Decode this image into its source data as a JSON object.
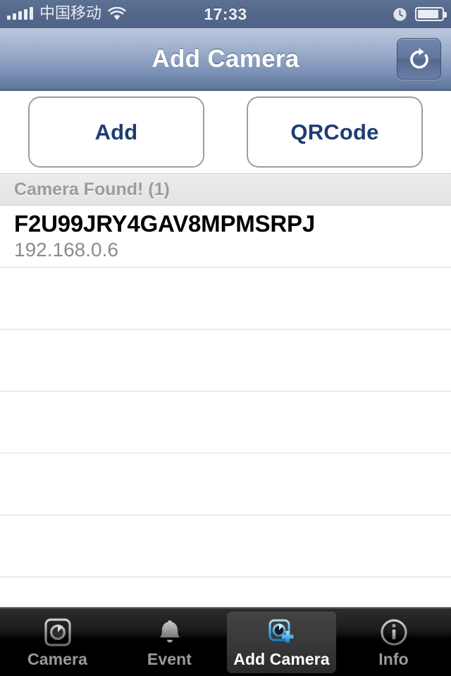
{
  "status_bar": {
    "carrier": "中国移动",
    "time": "17:33",
    "signal_bars": 5,
    "wifi_icon": "wifi-icon",
    "clock_icon": "clock-icon",
    "battery_icon": "battery-icon"
  },
  "nav_bar": {
    "title": "Add Camera",
    "refresh_icon": "refresh-icon"
  },
  "actions": {
    "add_label": "Add",
    "qrcode_label": "QRCode"
  },
  "section": {
    "header": "Camera Found! (1)"
  },
  "camera_list": [
    {
      "id": "F2U99JRY4GAV8MPMSRPJ",
      "ip": "192.168.0.6"
    }
  ],
  "empty_rows": 5,
  "tab_bar": {
    "items": [
      {
        "label": "Camera",
        "icon": "camera-icon",
        "selected": false
      },
      {
        "label": "Event",
        "icon": "bell-icon",
        "selected": false
      },
      {
        "label": "Add Camera",
        "icon": "add-camera-icon",
        "selected": true
      },
      {
        "label": "Info",
        "icon": "info-icon",
        "selected": false
      }
    ]
  },
  "colors": {
    "nav_bar_top": "#bcc9de",
    "nav_bar_bottom": "#56688d",
    "button_text": "#1f3d73",
    "section_header_bg": "#e8e8e8",
    "section_header_text": "#9b9b9b",
    "row_title": "#000000",
    "row_subtitle": "#8c8c8c",
    "tab_bar_bg": "#000000",
    "tab_label_inactive": "#9a9a9a",
    "tab_label_active": "#ffffff",
    "tab_selected_bg": "#3a3a3a",
    "add_camera_icon_accent": "#3ca9e8"
  }
}
